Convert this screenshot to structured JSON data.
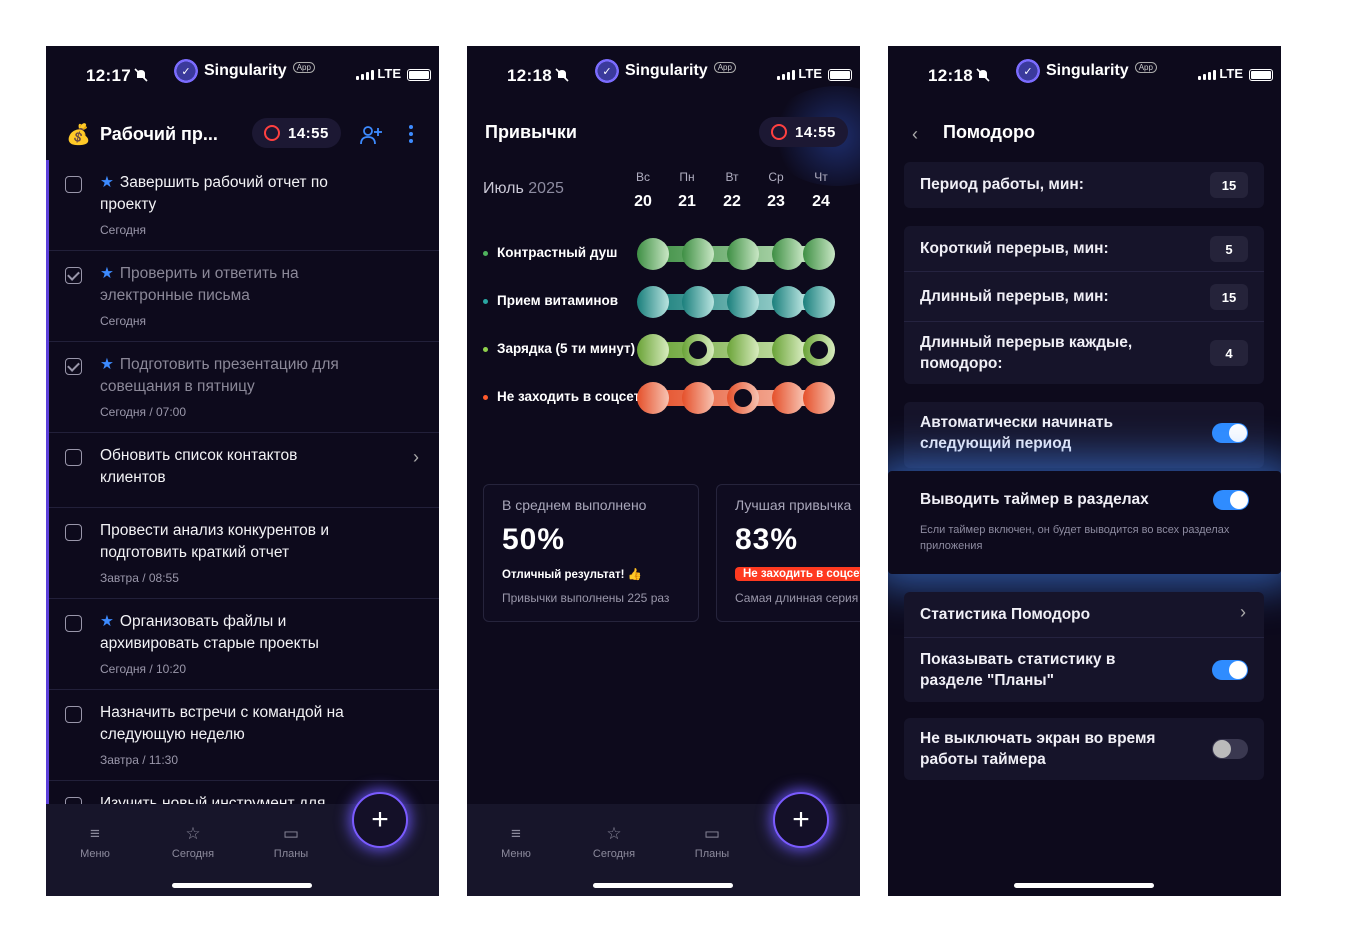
{
  "screens": [
    {
      "status": {
        "time": "12:17",
        "app_name": "Singularity",
        "app_tag": "App",
        "network": "LTE"
      },
      "header": {
        "title": "Рабочий пр...",
        "timer": "14:55"
      },
      "tasks": [
        {
          "text": "Завершить рабочий отчет по проекту",
          "sub": "Сегодня",
          "starred": true,
          "checked": false
        },
        {
          "text": "Проверить и ответить на электронные письма",
          "sub": "Сегодня",
          "starred": true,
          "checked": true
        },
        {
          "text": "Подготовить презентацию для совещания в пятницу",
          "sub": "Сегодня / 07:00",
          "starred": true,
          "checked": true
        },
        {
          "text": "Обновить список контактов клиентов",
          "sub": "",
          "starred": false,
          "checked": false
        },
        {
          "text": "Провести анализ конкурентов и подготовить краткий отчет",
          "sub": "Завтра / 08:55",
          "starred": false,
          "checked": false
        },
        {
          "text": "Организовать файлы и архивировать старые проекты",
          "sub": "Сегодня / 10:20",
          "starred": true,
          "checked": false
        },
        {
          "text": "Назначить встречи с командой на следующую неделю",
          "sub": "Завтра / 11:30",
          "starred": false,
          "checked": false
        },
        {
          "text": "Изучить новый инструмент для",
          "sub": "",
          "starred": false,
          "checked": false
        }
      ],
      "tabbar": {
        "menu": "Меню",
        "today": "Сегодня",
        "plans": "Планы",
        "fab": "+"
      }
    },
    {
      "status": {
        "time": "12:18",
        "app_name": "Singularity",
        "app_tag": "App",
        "network": "LTE"
      },
      "header": {
        "title": "Привычки",
        "timer": "14:55"
      },
      "month": {
        "name": "Июль",
        "year": "2025"
      },
      "days": [
        {
          "name": "Вс",
          "num": "20"
        },
        {
          "name": "Пн",
          "num": "21"
        },
        {
          "name": "Вт",
          "num": "22"
        },
        {
          "name": "Ср",
          "num": "23"
        },
        {
          "name": "Чт",
          "num": "24"
        }
      ],
      "habits": [
        {
          "name": "Контрастный душ",
          "color": "#4fb35d",
          "from": "#3e8f44",
          "to": "#c9e7c5",
          "missed": []
        },
        {
          "name": "Прием витаминов",
          "color": "#2aa7a3",
          "from": "#1a7f7c",
          "to": "#b9e4e0",
          "missed": []
        },
        {
          "name": "Зарядка (5 ти минут)",
          "color": "#8fd14c",
          "from": "#6aa337",
          "to": "#d8ecbf",
          "missed": [
            1,
            4
          ]
        },
        {
          "name": "Не заходить в соцсети",
          "color": "#ff5a2c",
          "from": "#e5502a",
          "to": "#f7c3b2",
          "missed": [
            2
          ]
        }
      ],
      "cards": [
        {
          "label": "В среднем выполнено",
          "value": "50%",
          "note": "Отличный результат! 👍",
          "small": "Привычки выполнены 225 раз"
        },
        {
          "label": "Лучшая привычка",
          "value": "83%",
          "tag": "Не заходить в соцсети",
          "small": "Самая длинная серия"
        }
      ],
      "tabbar": {
        "menu": "Меню",
        "today": "Сегодня",
        "plans": "Планы",
        "fab": "+"
      }
    },
    {
      "status": {
        "time": "12:18",
        "app_name": "Singularity",
        "app_tag": "App",
        "network": "LTE"
      },
      "header": {
        "title": "Помодоро"
      },
      "work": {
        "label": "Период работы, мин:",
        "value": "15"
      },
      "short_break": {
        "label": "Короткий перерыв, мин:",
        "value": "5"
      },
      "long_break": {
        "label": "Длинный перерыв, мин:",
        "value": "15"
      },
      "long_every": {
        "label": "Длинный перерыв каждые, помодоро:",
        "value": "4"
      },
      "auto_start": {
        "label": "Автоматически начинать следующий период",
        "on": true
      },
      "show_timer": {
        "label": "Выводить таймер в разделах",
        "hint": "Если таймер включен, он будет выводится во всех разделах приложения",
        "on": true
      },
      "stats": {
        "label": "Статистика Помодоро"
      },
      "show_stats": {
        "label": "Показывать статистику в разделе \"Планы\"",
        "on": true
      },
      "keep_screen": {
        "label": "Не выключать экран во время работы таймера",
        "on": false
      }
    }
  ]
}
